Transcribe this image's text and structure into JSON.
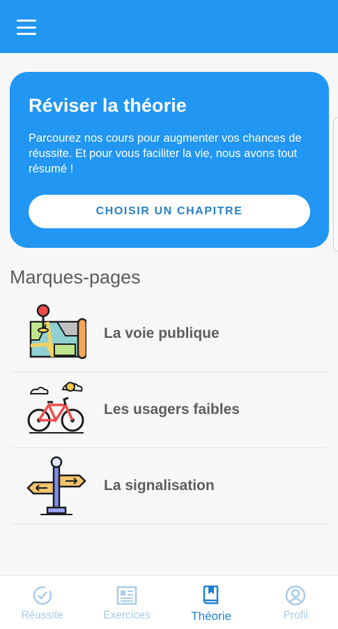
{
  "header": {
    "menu_icon": "hamburger-menu-icon"
  },
  "hero": {
    "title": "Réviser la théorie",
    "description": "Parcourez nos cours pour augmenter vos chances de réussite. Et pour vous faciliter la vie, nous avons tout résumé !",
    "button_label": "CHOISIR UN CHAPITRE"
  },
  "bookmarks": {
    "title": "Marques-pages",
    "items": [
      {
        "label": "La voie publique",
        "icon": "map-pin-icon"
      },
      {
        "label": "Les usagers faibles",
        "icon": "bicycle-icon"
      },
      {
        "label": "La signalisation",
        "icon": "signpost-icon"
      }
    ]
  },
  "nav": {
    "items": [
      {
        "label": "Réussite",
        "icon": "check-circle-icon",
        "active": false
      },
      {
        "label": "Exercices",
        "icon": "worksheet-icon",
        "active": false
      },
      {
        "label": "Théorie",
        "icon": "book-icon",
        "active": true
      },
      {
        "label": "Profil",
        "icon": "user-circle-icon",
        "active": false
      }
    ]
  },
  "colors": {
    "primary": "#2196f3",
    "button_text": "#2680c8",
    "nav_active": "#1f80d0",
    "nav_inactive": "#a9cbe8"
  }
}
